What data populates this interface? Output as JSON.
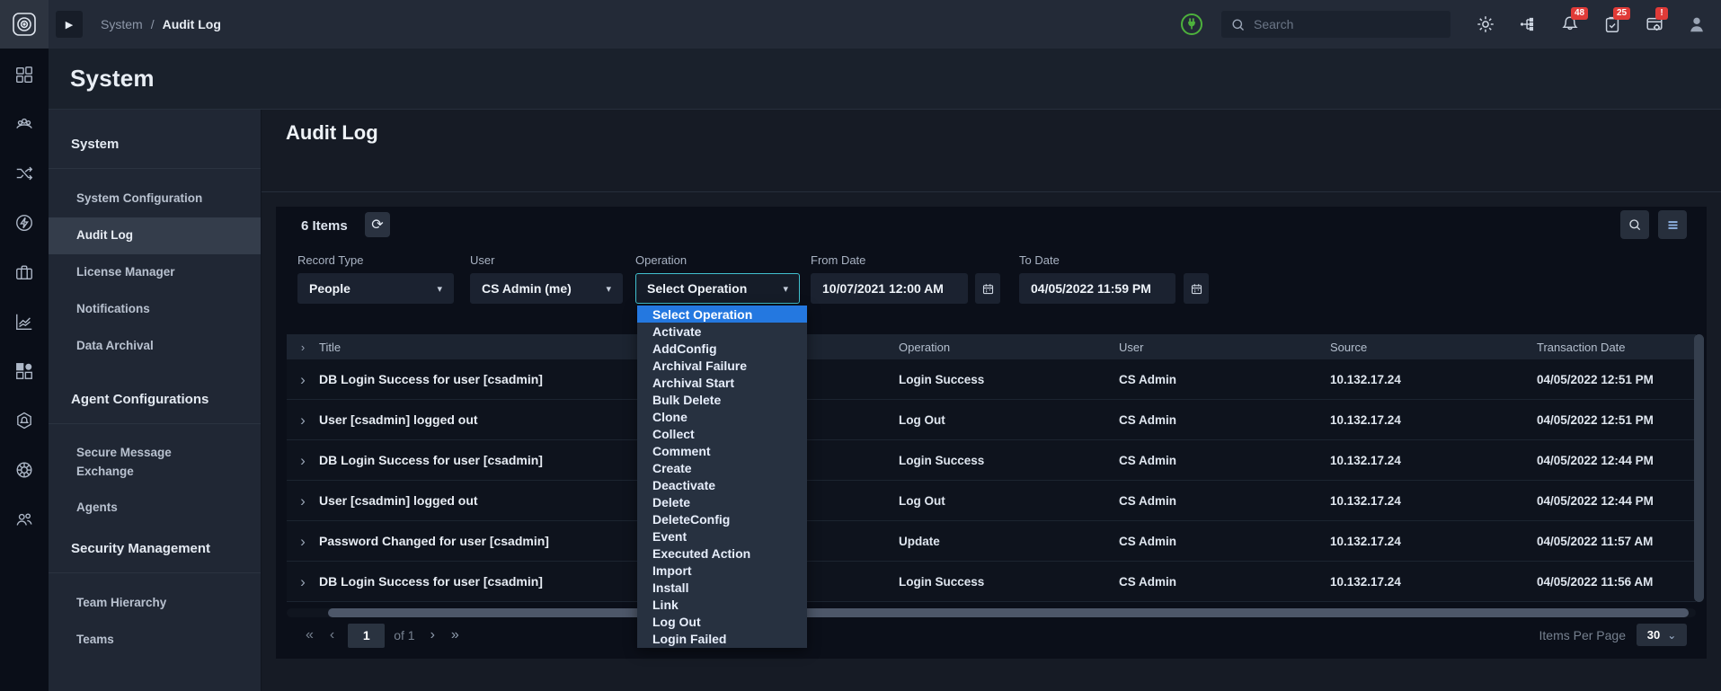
{
  "colors": {
    "accent_teal": "#41c0ce",
    "highlight_blue": "#2478e0",
    "badge_red": "#e03b38",
    "status_green": "#4db13c"
  },
  "icons": {
    "expand_breadcrumb": "▶",
    "refresh": "⟳",
    "caret_down": "▾",
    "row_chevron": "›",
    "page_first": "«",
    "page_prev": "‹",
    "page_next": "›",
    "page_last": "»",
    "select_caret": "⌄"
  },
  "topbar": {
    "breadcrumb": {
      "parent": "System",
      "separator": "/",
      "current": "Audit Log"
    },
    "search": {
      "placeholder": "Search"
    },
    "badges": {
      "bell": "48",
      "tasks": "25",
      "system": "!"
    }
  },
  "page_title": "System",
  "sidebar": {
    "section1_title": "System",
    "active_item": "Audit Log",
    "groups": [
      {
        "items": [
          "System Configuration",
          "Audit Log",
          "License Manager",
          "Notifications",
          "Data Archival"
        ]
      },
      {
        "header": "Agent Configurations",
        "items": [
          "Secure Message Exchange",
          "Agents"
        ]
      },
      {
        "header": "Security Management",
        "items": [
          "Team Hierarchy",
          "Teams"
        ]
      }
    ]
  },
  "main": {
    "heading": "Audit Log",
    "toolbar": {
      "items_count": "6 Items"
    },
    "filters": {
      "record_type": {
        "label": "Record Type",
        "value": "People"
      },
      "user": {
        "label": "User",
        "value": "CS Admin (me)"
      },
      "operation": {
        "label": "Operation",
        "value": "Select Operation"
      },
      "from_date": {
        "label": "From Date",
        "value": "10/07/2021 12:00 AM"
      },
      "to_date": {
        "label": "To Date",
        "value": "04/05/2022 11:59 PM"
      }
    },
    "operation_dropdown": {
      "selected_index": 0,
      "options": [
        "Select Operation",
        "Activate",
        "AddConfig",
        "Archival Failure",
        "Archival Start",
        "Bulk Delete",
        "Clone",
        "Collect",
        "Comment",
        "Create",
        "Deactivate",
        "Delete",
        "DeleteConfig",
        "Event",
        "Executed Action",
        "Import",
        "Install",
        "Link",
        "Log Out",
        "Login Failed"
      ]
    },
    "table": {
      "columns": [
        "Title",
        "Operation",
        "User",
        "Source",
        "Transaction Date"
      ],
      "rows": [
        {
          "title": "DB Login Success for user [csadmin]",
          "operation": "Login Success",
          "user": "CS Admin",
          "source": "10.132.17.24",
          "date": "04/05/2022 12:51 PM"
        },
        {
          "title": "User [csadmin] logged out",
          "operation": "Log Out",
          "user": "CS Admin",
          "source": "10.132.17.24",
          "date": "04/05/2022 12:51 PM"
        },
        {
          "title": "DB Login Success for user [csadmin]",
          "operation": "Login Success",
          "user": "CS Admin",
          "source": "10.132.17.24",
          "date": "04/05/2022 12:44 PM"
        },
        {
          "title": "User [csadmin] logged out",
          "operation": "Log Out",
          "user": "CS Admin",
          "source": "10.132.17.24",
          "date": "04/05/2022 12:44 PM"
        },
        {
          "title": "Password Changed for user [csadmin]",
          "operation": "Update",
          "user": "CS Admin",
          "source": "10.132.17.24",
          "date": "04/05/2022 11:57 AM"
        },
        {
          "title": "DB Login Success for user [csadmin]",
          "operation": "Login Success",
          "user": "CS Admin",
          "source": "10.132.17.24",
          "date": "04/05/2022 11:56 AM"
        }
      ]
    },
    "pagination": {
      "current_page": "1",
      "of_label": "of 1"
    },
    "items_per_page": {
      "label": "Items Per Page",
      "value": "30"
    }
  }
}
